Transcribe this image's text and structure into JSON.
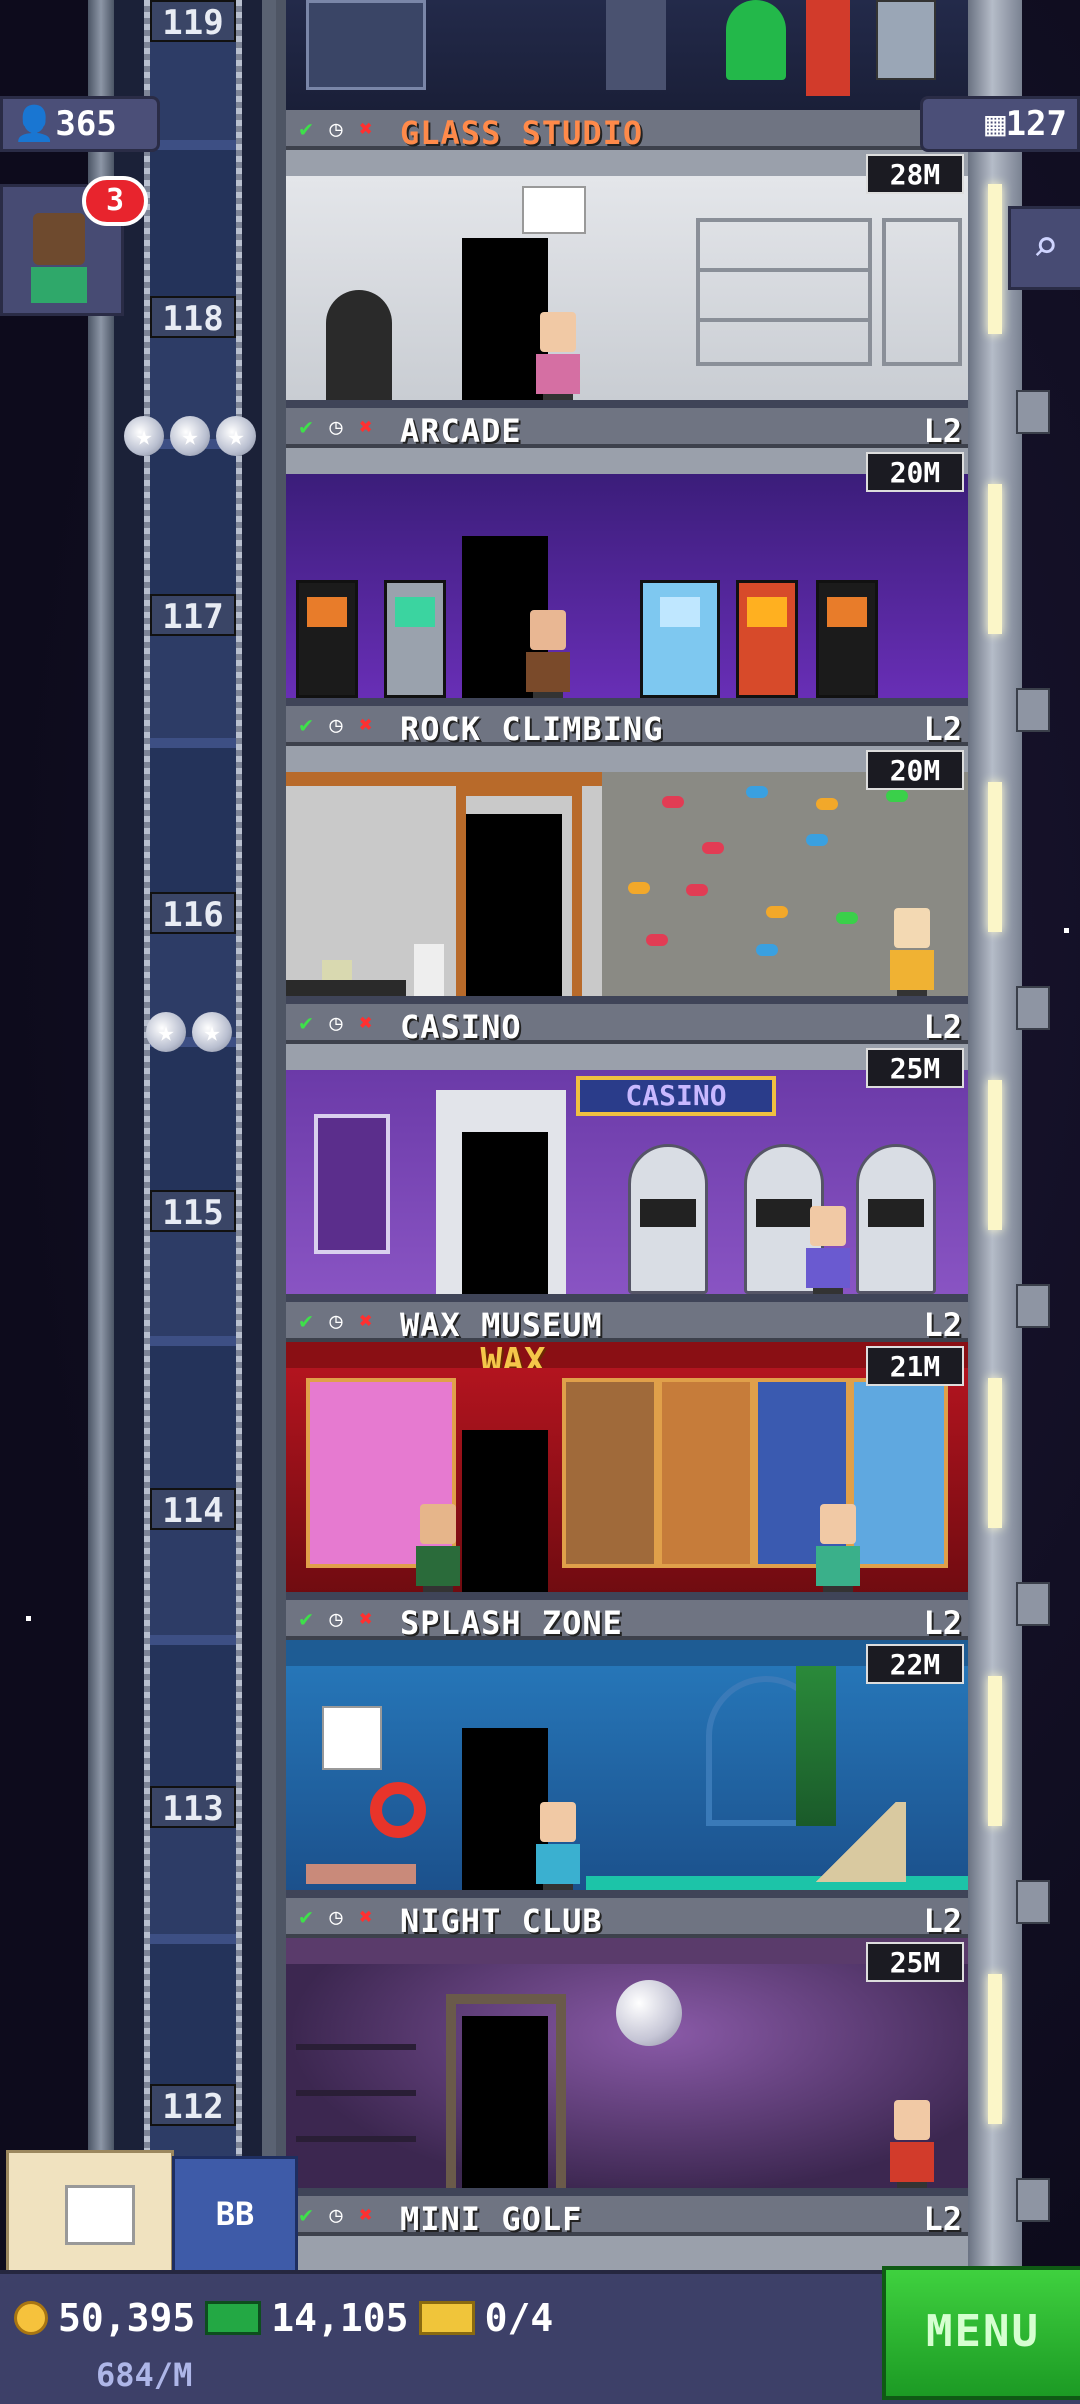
{
  "hud_top": {
    "population": "365",
    "floors": "127",
    "notification_count": "3"
  },
  "shaft_floor_numbers": [
    "119",
    "118",
    "117",
    "116",
    "115",
    "114",
    "113",
    "112"
  ],
  "floors": [
    {
      "name": "GLASS STUDIO",
      "level": "",
      "timer": "28M",
      "theme": "glass"
    },
    {
      "name": "ARCADE",
      "level": "L2",
      "timer": "20M",
      "theme": "arcade"
    },
    {
      "name": "ROCK CLIMBING",
      "level": "L2",
      "timer": "20M",
      "theme": "rock"
    },
    {
      "name": "CASINO",
      "level": "L2",
      "timer": "25M",
      "theme": "casino"
    },
    {
      "name": "WAX MUSEUM",
      "level": "L2",
      "timer": "21M",
      "theme": "wax"
    },
    {
      "name": "SPLASH ZONE",
      "level": "L2",
      "timer": "22M",
      "theme": "splash"
    },
    {
      "name": "NIGHT CLUB",
      "level": "L2",
      "timer": "25M",
      "theme": "night"
    },
    {
      "name": "MINI GOLF",
      "level": "L2",
      "timer": "",
      "theme": "mini"
    }
  ],
  "signs": {
    "casino": "CASINO",
    "wax": "WAX"
  },
  "hud_bottom": {
    "coins": "50,395",
    "bux": "14,105",
    "tickets": "0/4",
    "coin_rate": "684/M",
    "menu_label": "MENU",
    "bb_label": "BB"
  },
  "colors": {
    "menu_green": "#2fbf34",
    "badge_red": "#e8242d",
    "hud_purple": "#3d4068"
  }
}
